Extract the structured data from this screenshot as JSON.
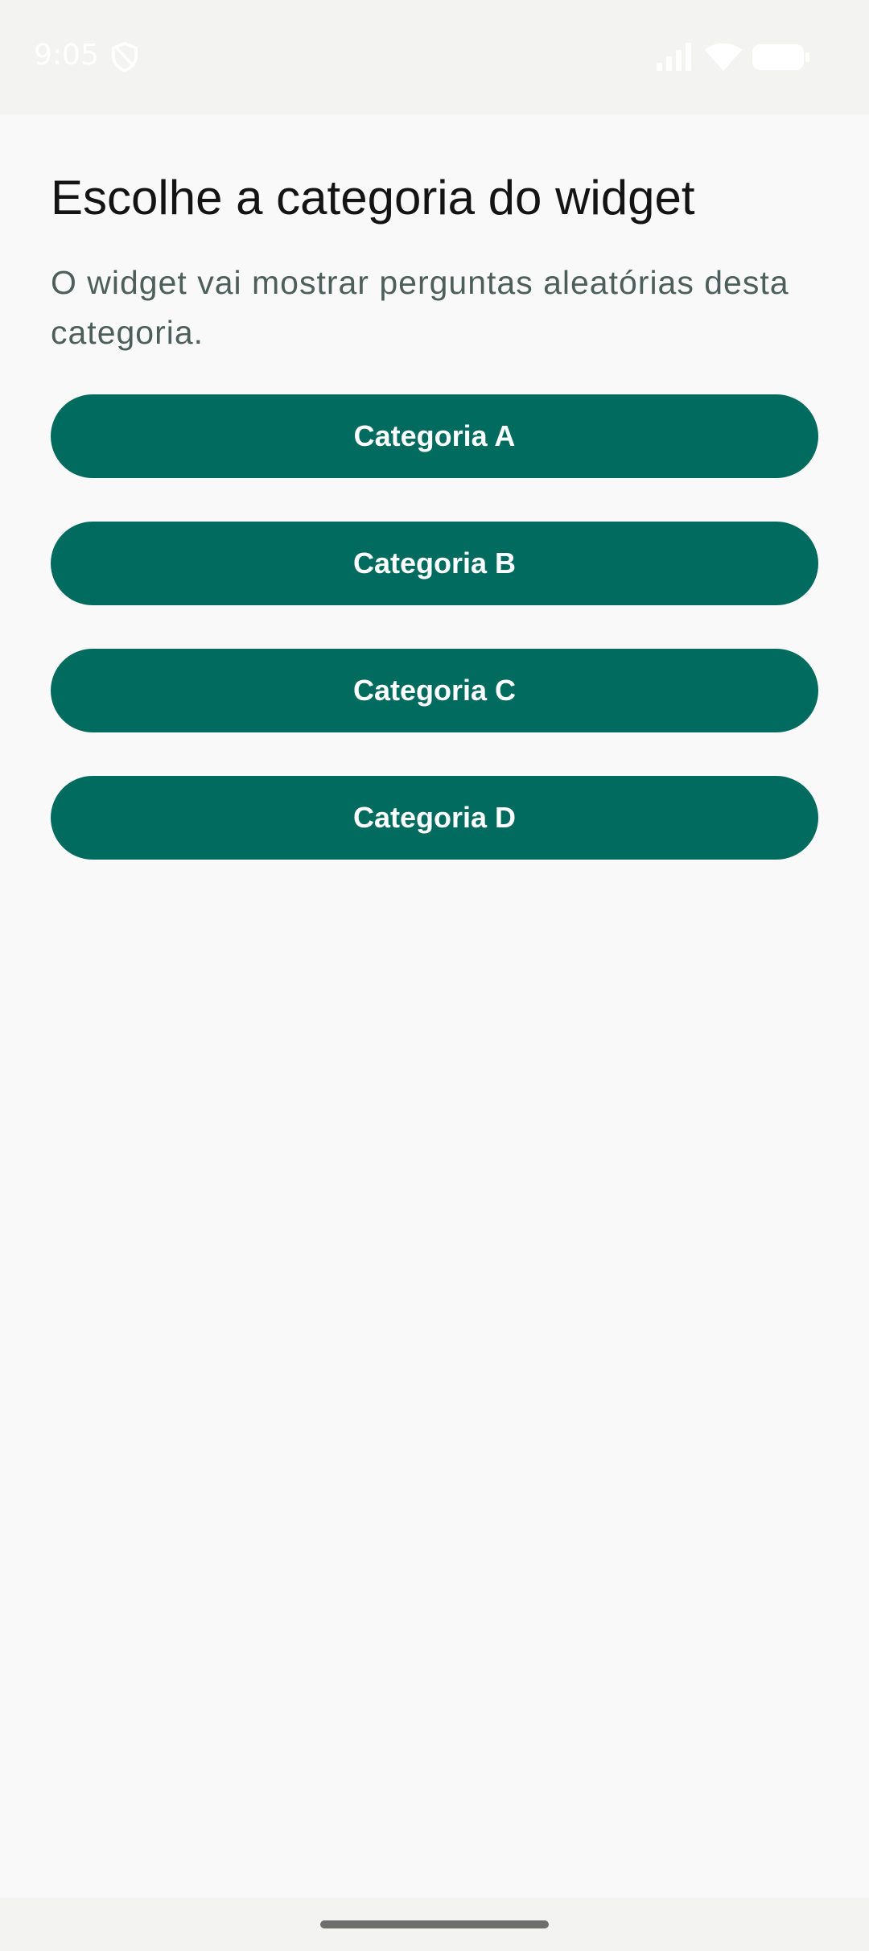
{
  "status_bar": {
    "time": "9:05",
    "icons": [
      "shield-icon",
      "signal-icon",
      "wifi-icon",
      "battery-icon"
    ]
  },
  "page": {
    "title": "Escolhe a categoria do widget",
    "subtitle": "O widget vai mostrar perguntas aleatórias desta categoria."
  },
  "categories": [
    {
      "label": "Categoria A"
    },
    {
      "label": "Categoria B"
    },
    {
      "label": "Categoria C"
    },
    {
      "label": "Categoria D"
    }
  ],
  "colors": {
    "accent": "#006b5e",
    "background": "#f9f9f9",
    "title_text": "#141414",
    "subtitle_text": "#4d5f5a",
    "button_text": "#ffffff"
  }
}
